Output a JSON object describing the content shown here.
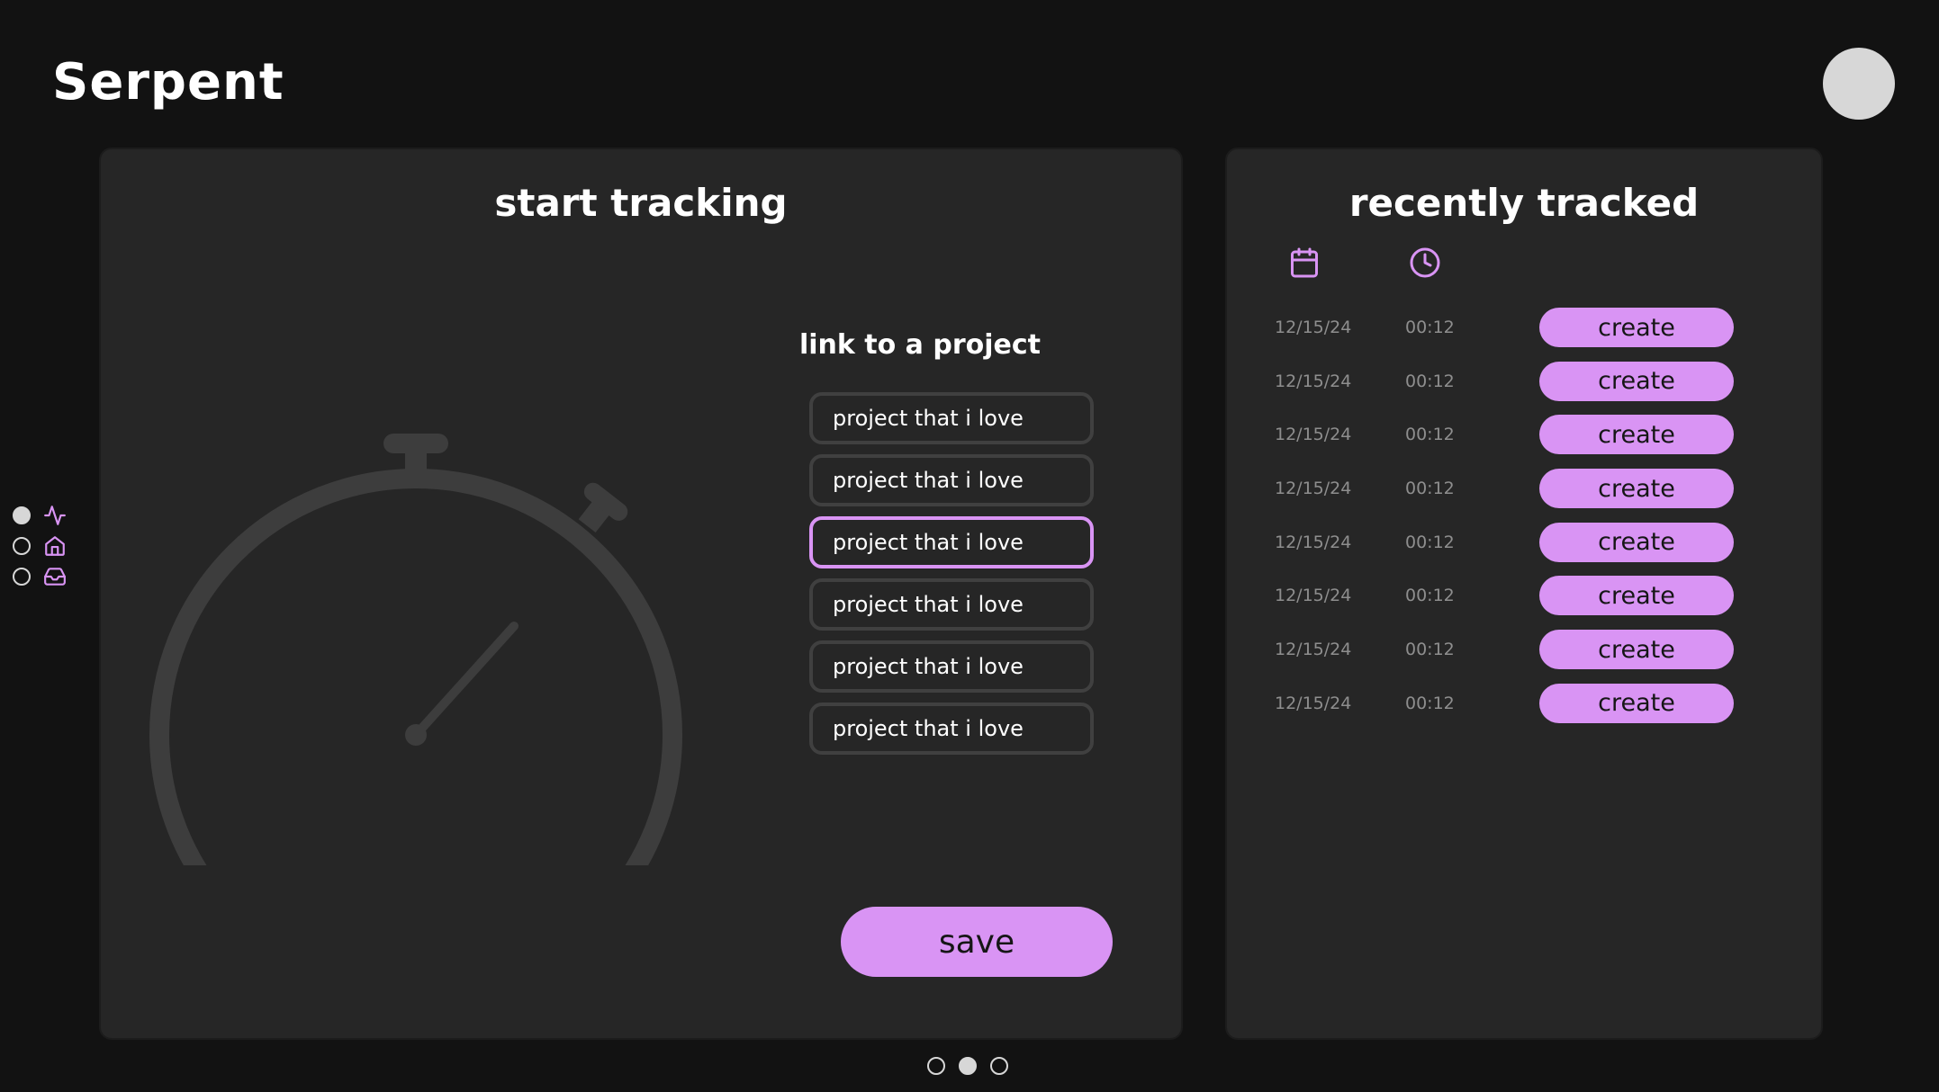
{
  "app": {
    "title": "Serpent"
  },
  "colors": {
    "accent": "#d994f4",
    "background": "#121212",
    "panel": "#262626",
    "border": "#404040",
    "muted_text": "#8e8e8e",
    "indicator": "#d7d7d7"
  },
  "sidebar": {
    "items": [
      {
        "icon": "activity-icon",
        "active": true
      },
      {
        "icon": "home-icon",
        "active": false
      },
      {
        "icon": "inbox-icon",
        "active": false
      }
    ]
  },
  "tracking": {
    "title": "start tracking",
    "project_heading": "link to a project",
    "projects": [
      {
        "label": "project that i love",
        "selected": false
      },
      {
        "label": "project that i love",
        "selected": false
      },
      {
        "label": "project that i love",
        "selected": true
      },
      {
        "label": "project that i love",
        "selected": false
      },
      {
        "label": "project that i love",
        "selected": false
      },
      {
        "label": "project that i love",
        "selected": false
      }
    ],
    "save_label": "save"
  },
  "recent": {
    "title": "recently tracked",
    "columns": [
      "calendar-icon",
      "clock-icon"
    ],
    "rows": [
      {
        "date": "12/15/24",
        "time": "00:12",
        "action": "create"
      },
      {
        "date": "12/15/24",
        "time": "00:12",
        "action": "create"
      },
      {
        "date": "12/15/24",
        "time": "00:12",
        "action": "create"
      },
      {
        "date": "12/15/24",
        "time": "00:12",
        "action": "create"
      },
      {
        "date": "12/15/24",
        "time": "00:12",
        "action": "create"
      },
      {
        "date": "12/15/24",
        "time": "00:12",
        "action": "create"
      },
      {
        "date": "12/15/24",
        "time": "00:12",
        "action": "create"
      },
      {
        "date": "12/15/24",
        "time": "00:12",
        "action": "create"
      }
    ]
  },
  "pagination": {
    "pages": 3,
    "current": 2
  }
}
